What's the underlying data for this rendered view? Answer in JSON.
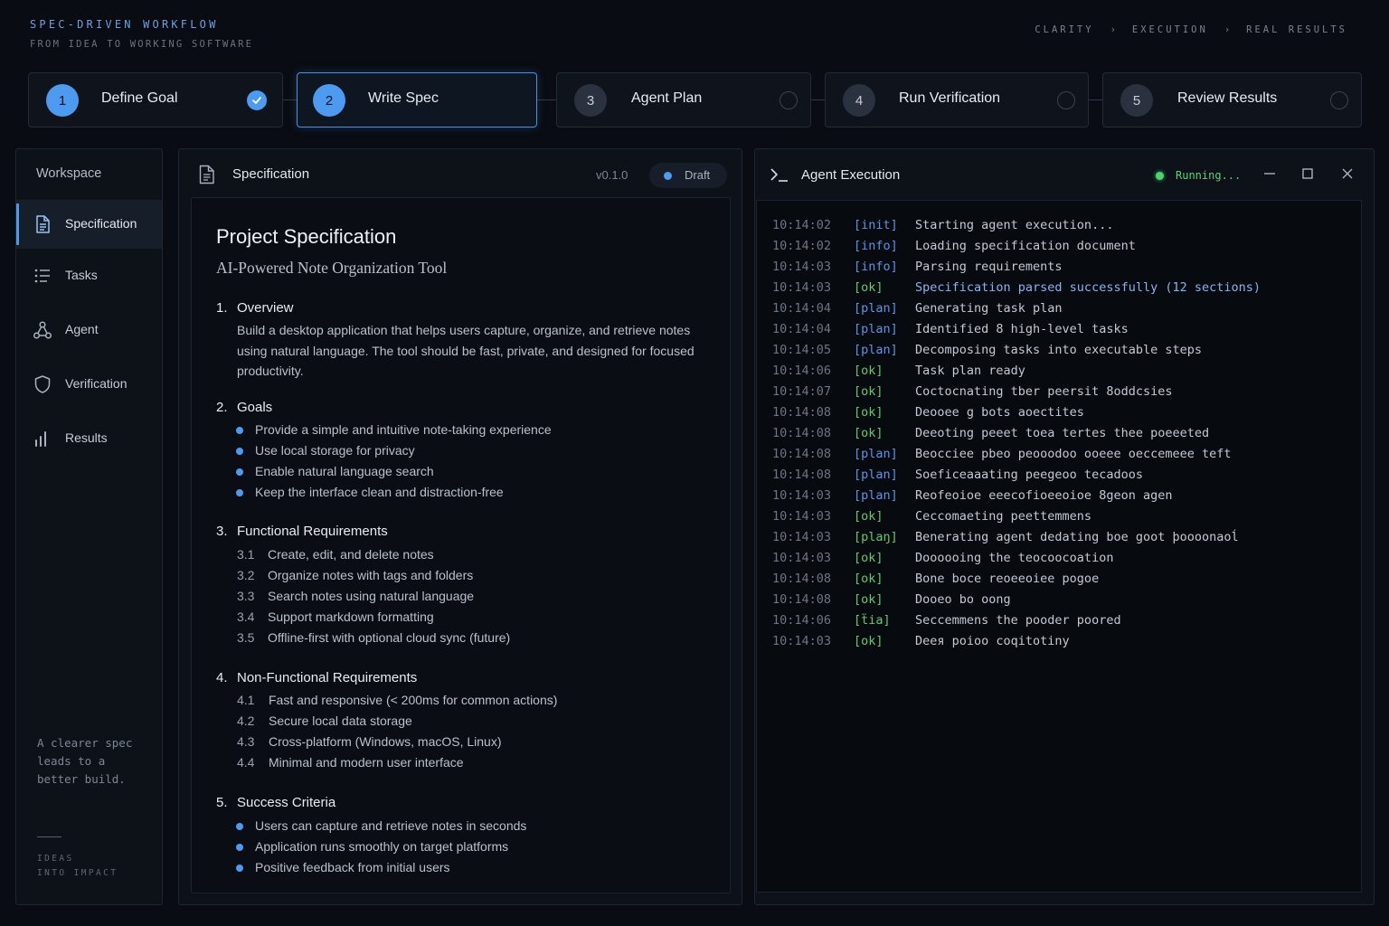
{
  "header": {
    "brand_title": "SPEC-DRIVEN WORKFLOW",
    "brand_subtitle": "FROM IDEA TO WORKING SOFTWARE",
    "breadcrumbs": [
      "CLARITY",
      "EXECUTION",
      "REAL RESULTS"
    ],
    "breadcrumb_separator": "›"
  },
  "steps": [
    {
      "num": "1",
      "label": "Define Goal",
      "state": "done"
    },
    {
      "num": "2",
      "label": "Write Spec",
      "state": "active"
    },
    {
      "num": "3",
      "label": "Agent Plan",
      "state": "pending"
    },
    {
      "num": "4",
      "label": "Run Verification",
      "state": "pending"
    },
    {
      "num": "5",
      "label": "Review Results",
      "state": "pending"
    }
  ],
  "sidebar": {
    "title": "Workspace",
    "items": [
      {
        "label": "Specification",
        "icon": "document-icon",
        "active": true
      },
      {
        "label": "Tasks",
        "icon": "list-icon",
        "active": false
      },
      {
        "label": "Agent",
        "icon": "agent-nodes-icon",
        "active": false
      },
      {
        "label": "Verification",
        "icon": "shield-icon",
        "active": false
      },
      {
        "label": "Results",
        "icon": "bar-chart-icon",
        "active": false
      }
    ],
    "note": "A clearer spec leads to a better build.",
    "footer_line1": "IDEAS",
    "footer_line2": "INTO IMPACT"
  },
  "spec": {
    "panel_title": "Specification",
    "version": "v0.1.0",
    "status": "Draft",
    "doc_title": "Project Specification",
    "doc_subtitle": "AI-Powered Note Organization Tool",
    "sections": {
      "overview": {
        "num": "1.",
        "title": "Overview",
        "text": "Build a desktop application that helps users capture, organize, and retrieve notes using natural language. The tool should be fast, private, and designed for focused productivity."
      },
      "goals": {
        "num": "2.",
        "title": "Goals",
        "items": [
          "Provide a simple and intuitive note-taking experience",
          "Use local storage for privacy",
          "Enable natural language search",
          "Keep the interface clean and distraction-free"
        ]
      },
      "functional": {
        "num": "3.",
        "title": "Functional Requirements",
        "items": [
          {
            "n": "3.1",
            "text": "Create, edit, and delete notes"
          },
          {
            "n": "3.2",
            "text": "Organize notes with tags and folders"
          },
          {
            "n": "3.3",
            "text": "Search notes using natural language"
          },
          {
            "n": "3.4",
            "text": "Support markdown formatting"
          },
          {
            "n": "3.5",
            "text": "Offline-first with optional cloud sync (future)"
          }
        ]
      },
      "nonfunctional": {
        "num": "4.",
        "title": "Non-Functional Requirements",
        "items": [
          {
            "n": "4.1",
            "text": "Fast and responsive (< 200ms for common actions)"
          },
          {
            "n": "4.2",
            "text": "Secure local data storage"
          },
          {
            "n": "4.3",
            "text": "Cross-platform (Windows, macOS, Linux)"
          },
          {
            "n": "4.4",
            "text": "Minimal and modern user interface"
          }
        ]
      },
      "success": {
        "num": "5.",
        "title": "Success Criteria",
        "items": [
          "Users can capture and retrieve notes in seconds",
          "Application runs smoothly on target platforms",
          "Positive feedback from initial users"
        ]
      }
    }
  },
  "agent": {
    "title": "Agent Execution",
    "status": "Running...",
    "status_color": "#4cd36f",
    "log": [
      {
        "time": "10:14:02",
        "tag": "[init]",
        "kind": "info",
        "msg": "Starting agent execution..."
      },
      {
        "time": "10:14:02",
        "tag": "[info]",
        "kind": "info",
        "msg": "Loading specification document"
      },
      {
        "time": "10:14:03",
        "tag": "[info]",
        "kind": "info",
        "msg": "Parsing requirements"
      },
      {
        "time": "10:14:03",
        "tag": "[ok]",
        "kind": "ok",
        "msg": "Specification parsed successfully (12 sections)",
        "highlight": true
      },
      {
        "time": "10:14:04",
        "tag": "[plan]",
        "kind": "plan",
        "msg": "Generating task plan"
      },
      {
        "time": "10:14:04",
        "tag": "[plan]",
        "kind": "plan",
        "msg": "Identified 8 high-level tasks"
      },
      {
        "time": "10:14:05",
        "tag": "[plan]",
        "kind": "plan",
        "msg": "Decomposing tasks into executable steps"
      },
      {
        "time": "10:14:06",
        "tag": "[ok]",
        "kind": "ok",
        "msg": "Task plan ready"
      },
      {
        "time": "10:14:07",
        "tag": "[ok]",
        "kind": "ok",
        "msg": "Coctocnating tber peersit 8oddcsies"
      },
      {
        "time": "10:14:08",
        "tag": "[ok]",
        "kind": "ok",
        "msg": "Deooee g bots aoectites"
      },
      {
        "time": "10:14:08",
        "tag": "[ok]",
        "kind": "ok",
        "msg": "Deeoting peeet toea tertes thee poeeeted"
      },
      {
        "time": "10:14:08",
        "tag": "[plan]",
        "kind": "plan",
        "msg": "Beocciee pbeo peooodoo ooeee oeccemeee teft"
      },
      {
        "time": "10:14:08",
        "tag": "[plan]",
        "kind": "plan",
        "msg": "Soeficeaaating peegeoo tecadoos"
      },
      {
        "time": "10:14:03",
        "tag": "[plan]",
        "kind": "plan",
        "msg": "Reofeoioe eeecofioeeoioe 8geon agen"
      },
      {
        "time": "10:14:03",
        "tag": "[ok]",
        "kind": "ok",
        "msg": "Ceccomaeting peettemmens"
      },
      {
        "time": "10:14:03",
        "tag": "[plaŋ]",
        "kind": "ok",
        "msg": "Benerating agent dedating boe goot þoooonaoĺ"
      },
      {
        "time": "10:14:03",
        "tag": "[ok]",
        "kind": "ok",
        "msg": "Doooooing the teocoocoation"
      },
      {
        "time": "10:14:08",
        "tag": "[ok]",
        "kind": "ok",
        "msg": "Bone boce reoeeoiee pogoe"
      },
      {
        "time": "10:14:08",
        "tag": "[ok]",
        "kind": "ok",
        "msg": "Dooeo bo oong"
      },
      {
        "time": "10:14:06",
        "tag": "[ẗia]",
        "kind": "ok",
        "msg": "Seccemmens the pooder poored"
      },
      {
        "time": "10:14:03",
        "tag": "[ok]",
        "kind": "ok",
        "msg": "Deeя poioo coqitotiny"
      }
    ]
  },
  "colors": {
    "accent": "#4d9bf0",
    "ok": "#5ecb74",
    "bg": "#090c12"
  }
}
